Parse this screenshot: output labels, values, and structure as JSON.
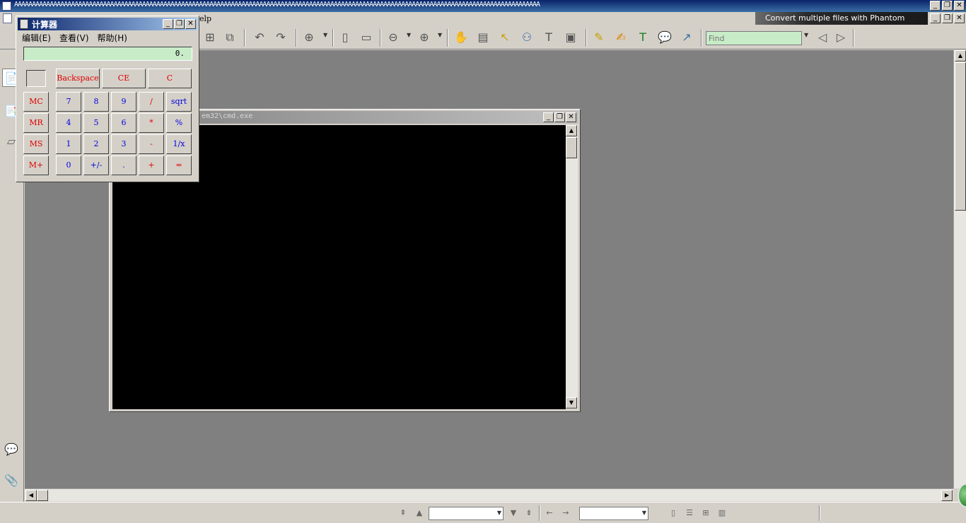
{
  "app": {
    "title": "AAAAAAAAAAAAAAAAAAAAAAAAAAAAAAAAAAAAAAAAAAAAAAAAAAAAAAAAAAAAAAAAAAAAAAAAAAAAAAAAAAAAAAAAAAAAAAAAAAAAAAAAAAAAAAAAAAAAAAAAAAAAAAAAAAAAAAAAAAAAAAAAAAAA",
    "menu_help": "elp",
    "banner": "Convert multiple files with Phantom",
    "find_placeholder": "Find",
    "window_buttons": {
      "minimize": "_",
      "restore": "❐",
      "close": "✕"
    },
    "colors": {
      "title_blue": "#0a246a",
      "find_green": "#c8ecc8",
      "canvas_gray": "#808080"
    }
  },
  "cmd": {
    "title": "em32\\cmd.exe"
  },
  "calculator": {
    "title": "计算器",
    "menu": [
      "编辑(E)",
      "查看(V)",
      "帮助(H)"
    ],
    "display": "0.",
    "top_buttons": [
      "Backspace",
      "CE",
      "C"
    ],
    "memory_buttons": [
      "MC",
      "MR",
      "MS",
      "M+"
    ],
    "rows": [
      [
        "7",
        "8",
        "9",
        "/",
        "sqrt"
      ],
      [
        "4",
        "5",
        "6",
        "*",
        "%"
      ],
      [
        "1",
        "2",
        "3",
        "-",
        "1/x"
      ],
      [
        "0",
        "+/-",
        ".",
        "+",
        "="
      ]
    ]
  }
}
